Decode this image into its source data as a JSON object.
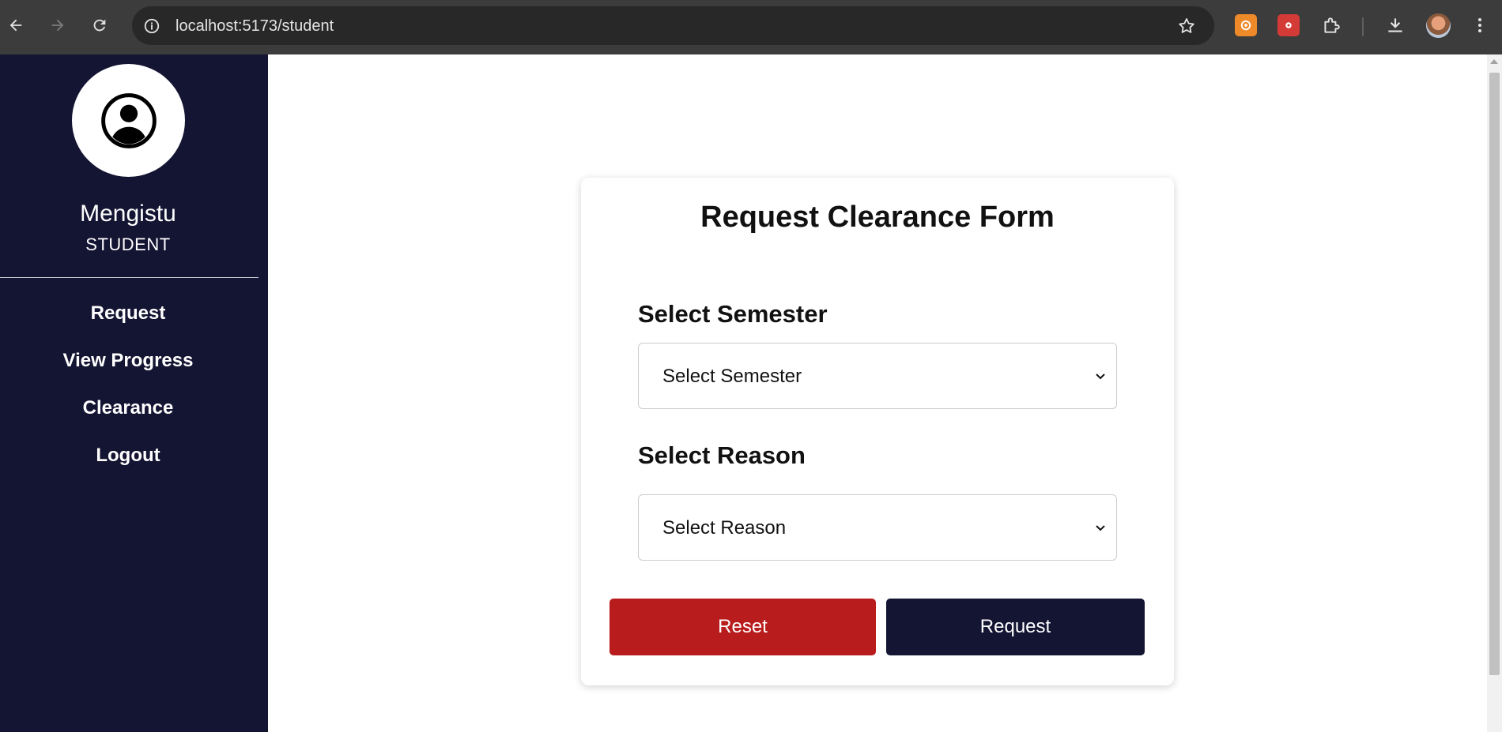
{
  "browser": {
    "url": "localhost:5173/student"
  },
  "sidebar": {
    "user_name": "Mengistu",
    "user_role": "STUDENT",
    "items": [
      {
        "label": "Request"
      },
      {
        "label": "View Progress"
      },
      {
        "label": "Clearance"
      },
      {
        "label": "Logout"
      }
    ]
  },
  "form": {
    "title": "Request Clearance Form",
    "semester_label": "Select Semester",
    "semester_value": "Select Semester",
    "reason_label": "Select Reason",
    "reason_value": "Select Reason",
    "reset_label": "Reset",
    "request_label": "Request"
  },
  "colors": {
    "sidebar_bg": "#141433",
    "reset_button": "#b91c1c",
    "request_button": "#141433"
  }
}
